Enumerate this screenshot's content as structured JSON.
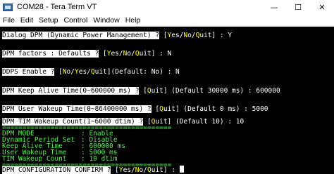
{
  "window": {
    "title": "COM28 - Tera Term VT"
  },
  "controls": {
    "minimize": "—",
    "maximize": "☐",
    "close": "✕"
  },
  "menu": [
    "File",
    "Edit",
    "Setup",
    "Control",
    "Window",
    "Help"
  ],
  "terminal": {
    "l1": {
      "prompt": "Dialog DPM (Dynamic Power Management) ?",
      "b1": " [",
      "k1": "Y",
      "t1": "es/",
      "k2": "N",
      "t2": "o/",
      "k3": "Q",
      "t3": "uit] : Y"
    },
    "l2": {
      "prompt": "DPM factors : Defaults ?",
      "b1": " [",
      "k1": "Y",
      "t1": "es/",
      "k2": "N",
      "t2": "o/",
      "k3": "Q",
      "t3": "uit] : N"
    },
    "l3": {
      "prompt": "DDPS Enable ?",
      "b1": " [",
      "k1": "N",
      "t1": "o/",
      "k2": "Y",
      "t2": "es/",
      "k3": "Q",
      "t3": "uit](Default: No) : N"
    },
    "l4": {
      "prompt": "DPM Keep Alive Time(0~600000 ms) ?",
      "b1": " [",
      "k1": "Q",
      "t1": "uit] (Default 30000 ms) : 600000"
    },
    "l5": {
      "prompt": "DPM User Wakeup Time(0~86400000 ms) ?",
      "b1": " [",
      "k1": "Q",
      "t1": "uit] (Default 0 ms) : 5000"
    },
    "l6": {
      "prompt": "DPM TIM Wakeup Count(1~6000 dtim) ?",
      "b1": " [",
      "k1": "Q",
      "t1": "uit] (Default 10) : 10"
    },
    "separator": "==========================================",
    "summary": [
      {
        "label": "DPM MODE",
        "value": "Enable"
      },
      {
        "label": "Dynamic Period Set",
        "value": "Disable"
      },
      {
        "label": "Keep Alive Time",
        "value": "600000 ms"
      },
      {
        "label": "User Wakeup Time",
        "value": "5000 ms"
      },
      {
        "label": "TIM Wakeup Count",
        "value": "10 dtim"
      }
    ],
    "l7": {
      "prompt": "DPM CONFIGURATION CONFIRM ?",
      "b1": " [",
      "k1": "Y",
      "t1": "es/",
      "k2": "N",
      "t2": "o/",
      "k3": "Q",
      "t3": "uit] : "
    }
  }
}
